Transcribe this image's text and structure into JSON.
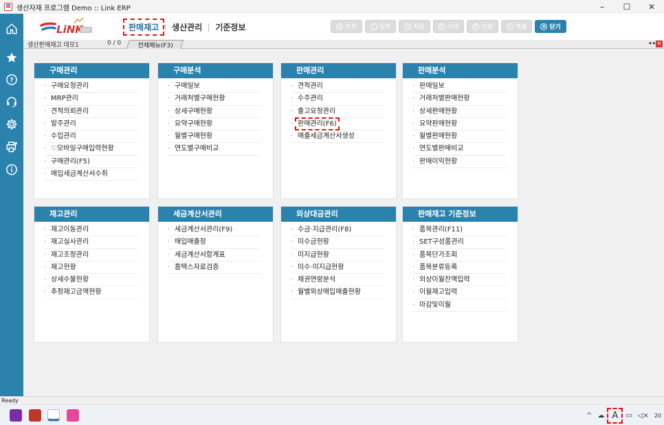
{
  "window": {
    "title": "생산자재 프로그램 Demo :: Link ERP",
    "controls": [
      "–",
      "☐",
      "✕"
    ]
  },
  "sidebar": {
    "icons": [
      "home-icon",
      "star-icon",
      "help-icon",
      "headset-icon",
      "gear-icon",
      "printer-settings-icon",
      "info-icon"
    ]
  },
  "header": {
    "logo_text": "LiNK",
    "logo_badge": "ERP",
    "nav": [
      {
        "label": "판매재고",
        "active": true
      },
      {
        "label": "생산관리",
        "active": false
      },
      {
        "label": "기준정보",
        "active": false
      }
    ],
    "toolbar": [
      {
        "icon": "◎",
        "label": "조회"
      },
      {
        "icon": "I",
        "label": "입력"
      },
      {
        "icon": "S",
        "label": "저장"
      },
      {
        "icon": "D",
        "label": "삭제"
      },
      {
        "icon": "P",
        "label": "인쇄"
      },
      {
        "icon": "E",
        "label": "엑셀"
      },
      {
        "icon": "X",
        "label": "닫기"
      }
    ]
  },
  "tabstrip": {
    "title": "생산판매재고 데모1",
    "count": "0 / 0",
    "tab_label": "전체메뉴(F3)",
    "arrows": "◂ ▸"
  },
  "menus": [
    {
      "title": "구매관리",
      "items": [
        "구매요청관리",
        "MRP관리",
        "견적의뢰관리",
        "발주관리",
        "수입관리",
        "♡모바일구매입력현황",
        "구매관리(F5)",
        "매입세금계산서수취"
      ]
    },
    {
      "title": "구매분석",
      "items": [
        "구매일보",
        "거래처별구매현황",
        "상세구매현황",
        "요약구매현황",
        "월별구매현황",
        "연도별구매비교"
      ]
    },
    {
      "title": "판매관리",
      "items": [
        "견적관리",
        "수주관리",
        "출고요청관리",
        "판매관리(F6)",
        "매출세금계산서생성"
      ]
    },
    {
      "title": "판매분석",
      "items": [
        "판매일보",
        "거래처별판매현황",
        "상세판매현황",
        "요약판매현황",
        "월별판매현황",
        "연도별판매비교",
        "판매이익현황"
      ]
    },
    {
      "title": "재고관리",
      "items": [
        "재고이동관리",
        "재고실사관리",
        "재고조정관리",
        "재고현황",
        "상세수불현황",
        "추정재고금액현황"
      ]
    },
    {
      "title": "세금계산서관리",
      "items": [
        "세금계산서관리(F9)",
        "매입매출장",
        "세금계산서합계표",
        "홈택스자료검증"
      ]
    },
    {
      "title": "외상대금관리",
      "items": [
        "수금·지급관리(F8)",
        "미수금현황",
        "미지급현황",
        "미수·미지급현황",
        "채권연령분석",
        "월별외상매입매출현황"
      ]
    },
    {
      "title": "판매재고 기준정보",
      "items": [
        "품목관리(F11)",
        "SET구성품관리",
        "품목단가조회",
        "품목분류등록",
        "외상이월잔액입력",
        "이월재고입력",
        "마감및이월"
      ]
    }
  ],
  "highlight": {
    "menu": 2,
    "item": 3
  },
  "status": {
    "text": "Ready"
  },
  "taskbar": {
    "apps": [
      "onenote-icon",
      "red-app-icon",
      "link-erp-icon",
      "kakaotalk-icon"
    ],
    "tray": {
      "chevron": "^",
      "ime": "A",
      "year_fragment": "20"
    }
  }
}
